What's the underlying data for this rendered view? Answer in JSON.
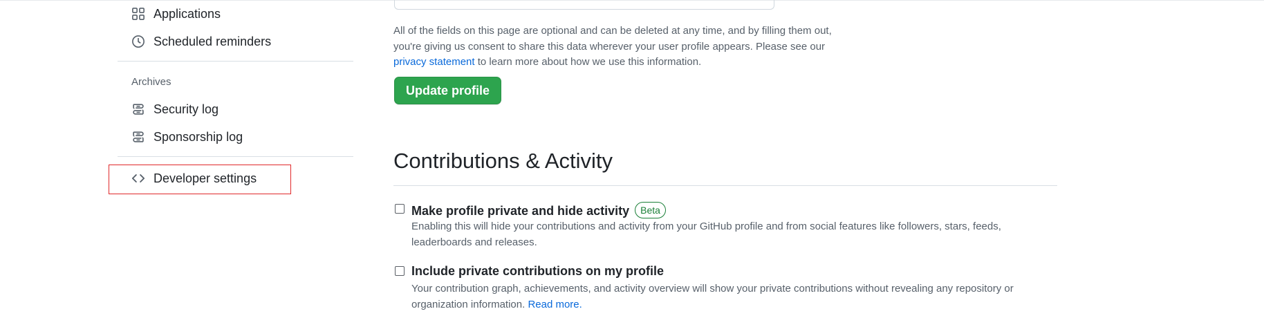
{
  "sidebar": {
    "items_top": [
      {
        "label": "Applications",
        "icon": "apps-icon"
      },
      {
        "label": "Scheduled reminders",
        "icon": "clock-icon"
      }
    ],
    "archives_heading": "Archives",
    "archives": [
      {
        "label": "Security log",
        "icon": "log-icon"
      },
      {
        "label": "Sponsorship log",
        "icon": "log-icon"
      }
    ],
    "developer": {
      "label": "Developer settings",
      "icon": "code-icon"
    }
  },
  "main": {
    "consent_before": "All of the fields on this page are optional and can be deleted at any time, and by filling them out, you're giving us consent to share this data wherever your user profile appears. Please see our ",
    "consent_link": "privacy statement",
    "consent_after": " to learn more about how we use this information.",
    "update_button": "Update profile",
    "section_title": "Contributions & Activity",
    "options": [
      {
        "label": "Make profile private and hide activity",
        "badge": "Beta",
        "description": "Enabling this will hide your contributions and activity from your GitHub profile and from social features like followers, stars, feeds, leaderboards and releases.",
        "checked": false
      },
      {
        "label": "Include private contributions on my profile",
        "description_before": "Your contribution graph, achievements, and activity overview will show your private contributions without revealing any repository or organization information. ",
        "read_more": "Read more.",
        "checked": false
      }
    ]
  },
  "colors": {
    "primary_button": "#2da44e",
    "link": "#0969da",
    "badge": "#1a7f37",
    "highlight": "#e0282a"
  }
}
